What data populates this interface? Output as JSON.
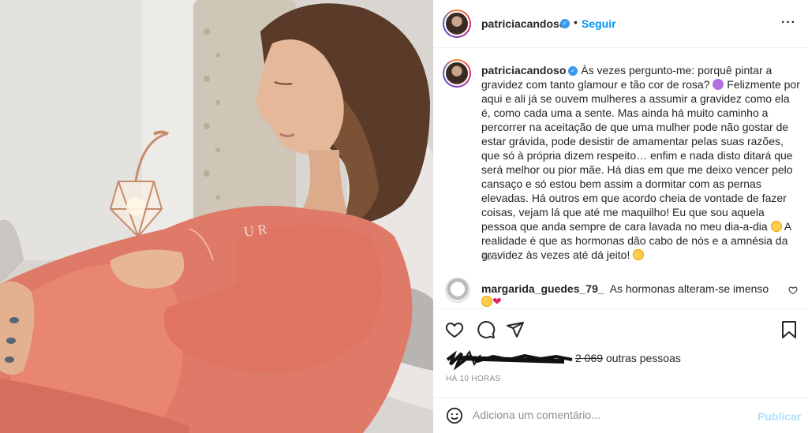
{
  "post": {
    "username": "patriciacandoso",
    "follow_label": "Seguir",
    "more_icon": "more-horizontal-icon",
    "dot": "•"
  },
  "caption": {
    "username": "patriciacandoso",
    "text_part1": "Às vezes pergunto-me: porquê pintar a gravidez com tanto glamour e tão cor de rosa?",
    "text_part2": "Felizmente por aqui e ali já se ouvem mulheres a assumir a gravidez como ela é, como cada uma a sente. Mas ainda há muito caminho a percorrer na aceitação de que uma mulher pode não gostar de estar grávida, pode desistir de amamentar pelas suas razões, que só à própria dizem respeito… enfim e nada disto ditará que será melhor ou pior mãe. Há dias em que me deixo vencer pelo cansaço e só estou bem assim a dormitar com as pernas elevadas. Há outros em que acordo cheia de vontade de fazer coisas, vejam lá que até me maquilho! Eu que sou aquela pessoa que anda sempre de cara lavada no meu dia-a-dia",
    "text_part3": "A realidade é que as hormonas dão cabo de nós e a amnésia da gravidez às vezes até dá jeito!",
    "time": "10 h"
  },
  "comment": {
    "username": "margarida_guedes_79_",
    "text": "As hormonas alteram-se imenso"
  },
  "likes": {
    "text": "outras pessoas",
    "count": "2 069"
  },
  "age": "HÁ 10 HORAS",
  "add_comment": {
    "placeholder": "Adiciona um comentário...",
    "publish_label": "Publicar"
  },
  "colors": {
    "accent": "#0095f6",
    "verified": "#3897f0",
    "publish_disabled": "#b2dffc",
    "sweater": "#e07a68"
  }
}
